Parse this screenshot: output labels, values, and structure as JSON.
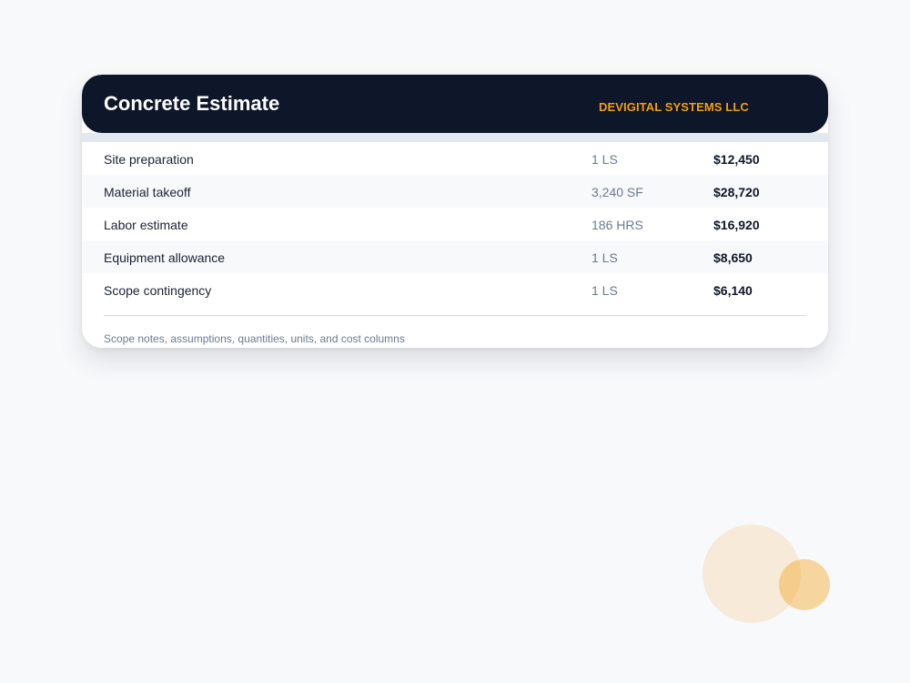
{
  "header": {
    "title": "Concrete Estimate",
    "company": "DEVIGITAL SYSTEMS LLC"
  },
  "rows": [
    {
      "description": "Site preparation",
      "quantity": "1 LS",
      "cost": "$12,450"
    },
    {
      "description": "Material takeoff",
      "quantity": "3,240 SF",
      "cost": "$28,720"
    },
    {
      "description": "Labor estimate",
      "quantity": "186 HRS",
      "cost": "$16,920"
    },
    {
      "description": "Equipment allowance",
      "quantity": "1 LS",
      "cost": "$8,650"
    },
    {
      "description": "Scope contingency",
      "quantity": "1 LS",
      "cost": "$6,140"
    }
  ],
  "footnote": "Scope notes, assumptions, quantities, units, and cost columns",
  "colors": {
    "header_bg": "#0e1629",
    "accent": "#f59f0b",
    "page_bg": "#f8f9fb"
  }
}
